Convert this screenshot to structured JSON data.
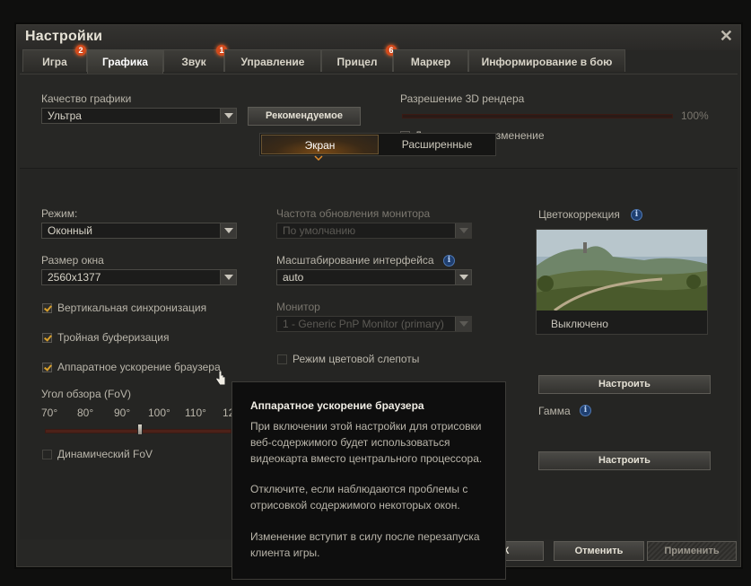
{
  "window": {
    "title": "Настройки"
  },
  "tabs": [
    {
      "label": "Игра",
      "badge": "2"
    },
    {
      "label": "Графика",
      "badge": ""
    },
    {
      "label": "Звук",
      "badge": "1"
    },
    {
      "label": "Управление",
      "badge": ""
    },
    {
      "label": "Прицел",
      "badge": "6"
    },
    {
      "label": "Маркер",
      "badge": ""
    },
    {
      "label": "Информирование в бою",
      "badge": ""
    }
  ],
  "top": {
    "quality_label": "Качество графики",
    "quality_value": "Ультра",
    "recommended_button": "Рекомендуемое",
    "resolution_label": "Разрешение 3D рендера",
    "resolution_value": "100%",
    "dynamic_change_label": "Динамическое изменение",
    "dynamic_change_checked": true
  },
  "subtabs": [
    "Экран",
    "Расширенные"
  ],
  "left": {
    "mode_label": "Режим:",
    "mode_value": "Оконный",
    "window_size_label": "Размер окна",
    "window_size_value": "2560x1377",
    "vsync_label": "Вертикальная синхронизация",
    "triple_buffer_label": "Тройная буферизация",
    "hw_accel_label": "Аппаратное ускорение браузера",
    "fov_label": "Угол обзора (FoV)",
    "fov_ticks": [
      "70°",
      "80°",
      "90°",
      "100°",
      "110°",
      "12"
    ],
    "dynamic_fov_label": "Динамический FoV"
  },
  "middle": {
    "refresh_label": "Частота обновления монитора",
    "refresh_value": "По умолчанию",
    "scaling_label": "Масштабирование интерфейса",
    "scaling_value": "auto",
    "monitor_label": "Монитор",
    "monitor_value": "1 - Generic PnP Monitor (primary)",
    "colorblind_label": "Режим цветовой слепоты"
  },
  "right": {
    "color_correction_label": "Цветокоррекция",
    "color_correction_state": "Выключено",
    "configure_button": "Настроить",
    "gamma_label": "Гамма",
    "gamma_button": "Настроить"
  },
  "tooltip": {
    "title": "Аппаратное ускорение браузера",
    "p1_l1": "При включении этой настройки для отрисовки",
    "p1_l2": "веб-содержимого будет использоваться",
    "p1_l3": "видеокарта вместо центрального процессора.",
    "p2_l1": "Отключите, если наблюдаются проблемы с",
    "p2_l2": "отрисовкой содержимого некоторых окон.",
    "p3_l1": "Изменение вступит в силу после перезапуска",
    "p3_l2": "клиента игры."
  },
  "footer": {
    "ok_partial": "К",
    "cancel_button": "Отменить",
    "apply_button": "Применить"
  },
  "colors": {
    "accent": "#d8a02c",
    "badge": "#d24a1c",
    "slider": "#4d2219"
  }
}
